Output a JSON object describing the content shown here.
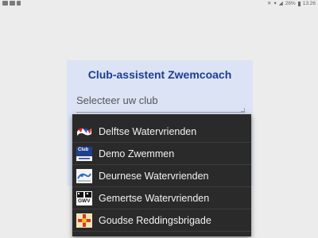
{
  "status_bar": {
    "battery": "26%",
    "time": "13:26"
  },
  "dialog": {
    "title": "Club-assistent Zwemcoach",
    "label": "Selecteer uw club"
  },
  "dropdown": {
    "items": [
      {
        "label": "Delftse Watervrienden",
        "logo": "dwv-logo"
      },
      {
        "label": "Demo Zwemmen",
        "logo": "demo-club-logo",
        "logo_text": "Club"
      },
      {
        "label": "Deurnese Watervrienden",
        "logo": "deurne-logo"
      },
      {
        "label": "Gemertse Watervrienden",
        "logo": "gemert-logo",
        "logo_text": "GWV"
      },
      {
        "label": "Goudse Reddingsbrigade",
        "logo": "gouda-logo"
      }
    ]
  },
  "colors": {
    "title": "#1f3c93",
    "dialog_bg": "#dce3f4",
    "dropdown_bg": "#2a2a2a"
  }
}
